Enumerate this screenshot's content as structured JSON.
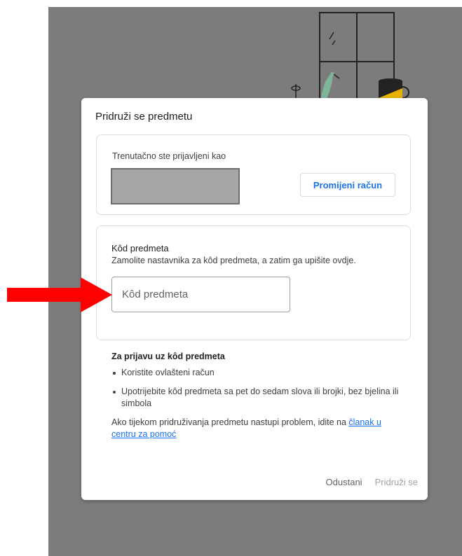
{
  "dialog": {
    "title": "Pridruži se predmetu",
    "account": {
      "signed_in_label": "Trenutačno ste prijavljeni kao",
      "switch_button": "Promijeni račun"
    },
    "class_code": {
      "heading": "Kôd predmeta",
      "help": "Zamolite nastavnika za kôd predmeta, a zatim ga upišite ovdje.",
      "input_value": "",
      "input_placeholder": "Kôd predmeta"
    },
    "info": {
      "title": "Za prijavu uz kôd predmeta",
      "bullets": [
        "Koristite ovlašteni račun",
        "Upotrijebite kôd predmeta sa pet do sedam slova ili brojki, bez bjelina ili simbola"
      ],
      "problem_text": "Ako tijekom pridruživanja predmetu nastupi problem, idite na ",
      "problem_link": "članak u centru za pomoć"
    },
    "actions": {
      "cancel": "Odustani",
      "join": "Pridruži se"
    }
  },
  "colors": {
    "accent": "#1a73e8",
    "backdrop": "#7c7c7c",
    "annotation_arrow": "#ff0000",
    "redacted_box": "#a6a6a6"
  }
}
